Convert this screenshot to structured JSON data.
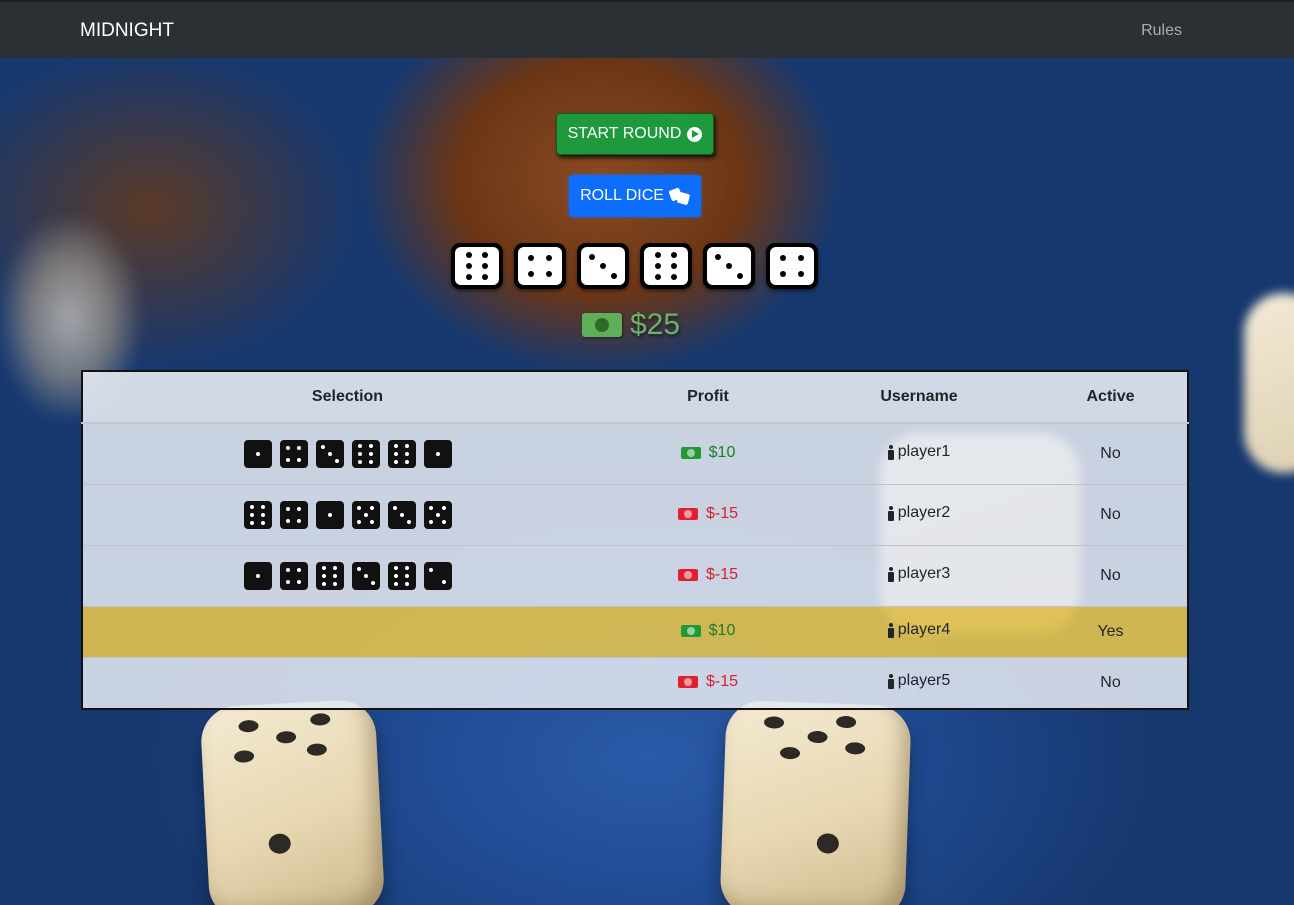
{
  "navbar": {
    "brand": "MIDNIGHT",
    "rules_link": "Rules"
  },
  "controls": {
    "start_label": "START ROUND",
    "start_icon": "play-circle-icon",
    "roll_label": "ROLL DICE",
    "roll_icon": "dice-icon"
  },
  "current_dice": [
    6,
    4,
    3,
    6,
    3,
    4
  ],
  "bank": {
    "icon": "money-bill-icon",
    "amount": "$25"
  },
  "table": {
    "headers": {
      "selection": "Selection",
      "profit": "Profit",
      "username": "Username",
      "active": "Active"
    },
    "rows": [
      {
        "selection": [
          1,
          4,
          3,
          6,
          6,
          1
        ],
        "profit": "$10",
        "profit_sign": "positive",
        "username": "player1",
        "active": "No"
      },
      {
        "selection": [
          6,
          4,
          1,
          5,
          3,
          5
        ],
        "profit": "$-15",
        "profit_sign": "negative",
        "username": "player2",
        "active": "No"
      },
      {
        "selection": [
          1,
          4,
          6,
          3,
          6,
          2
        ],
        "profit": "$-15",
        "profit_sign": "negative",
        "username": "player3",
        "active": "No"
      },
      {
        "selection": [],
        "profit": "$10",
        "profit_sign": "positive",
        "username": "player4",
        "active": "Yes",
        "highlighted": true
      },
      {
        "selection": [],
        "profit": "$-15",
        "profit_sign": "negative",
        "username": "player5",
        "active": "No"
      }
    ]
  },
  "colors": {
    "navbar": "#2b3035",
    "start_button": "#1e9a3c",
    "roll_button": "#0d6efd",
    "positive": "#1b7f2a",
    "negative": "#d3212f",
    "active_row": "#dec050"
  }
}
